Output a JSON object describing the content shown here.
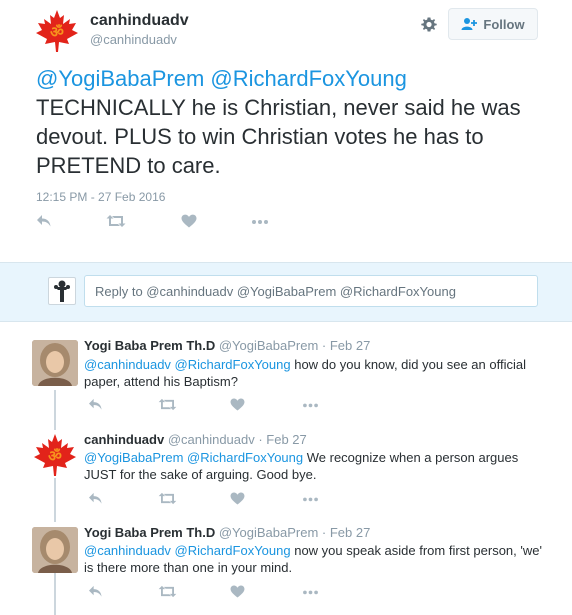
{
  "main_tweet": {
    "name": "canhinduadv",
    "handle": "@canhinduadv",
    "follow_label": "Follow",
    "mention_1": "@YogiBabaPrem",
    "mention_2": "@RichardFoxYoung",
    "text": "TECHNICALLY he is Christian, never said he was devout. PLUS to win Christian votes he has to PRETEND to care.",
    "timestamp": "12:15 PM - 27 Feb 2016",
    "avatar_icon": "maple-leaf-om-icon"
  },
  "reply_box": {
    "placeholder": "Reply to @canhinduadv @YogiBabaPrem @RichardFoxYoung"
  },
  "replies": [
    {
      "name": "Yogi Baba Prem Th.D",
      "meta": "@YogiBabaPrem · Feb 27",
      "mentions": "@canhinduadv @RichardFoxYoung",
      "text": " how do you know, did you see an official paper, attend his Baptism?"
    },
    {
      "name": "canhinduadv",
      "meta": "@canhinduadv · Feb 27",
      "mentions": "@YogiBabaPrem @RichardFoxYoung",
      "text": " We recognize when a person argues JUST for the sake of arguing. Good bye."
    },
    {
      "name": "Yogi Baba Prem Th.D",
      "meta": "@YogiBabaPrem · Feb 27",
      "mentions": "@canhinduadv @RichardFoxYoung",
      "text": " now you speak aside from first person, 'we' is there more than one in your mind."
    }
  ],
  "colors": {
    "link": "#1b95e0",
    "maple_red": "#e2231a",
    "om_orange": "#f26722",
    "muted": "#8899a6",
    "icon": "#aab8c2"
  }
}
